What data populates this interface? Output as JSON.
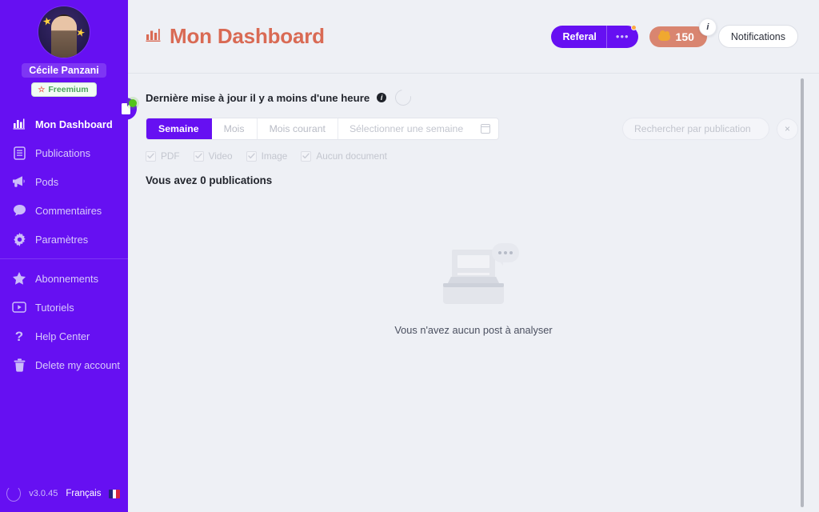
{
  "sidebar": {
    "avatar_alt": "user-avatar-photo",
    "username": "Cécile Panzani",
    "plan": "Freemium",
    "plan_icon": "star-outline-icon",
    "nav_groups": [
      {
        "items": [
          {
            "label": "Mon Dashboard",
            "icon": "bar-chart-icon",
            "active": true
          },
          {
            "label": "Publications",
            "icon": "document-icon",
            "active": false
          },
          {
            "label": "Pods",
            "icon": "megaphone-icon",
            "active": false
          },
          {
            "label": "Commentaires",
            "icon": "speech-bubble-icon",
            "active": false
          },
          {
            "label": "Paramètres",
            "icon": "gear-icon",
            "active": false
          }
        ]
      },
      {
        "items": [
          {
            "label": "Abonnements",
            "icon": "star-filled-icon",
            "active": false
          },
          {
            "label": "Tutoriels",
            "icon": "video-play-icon",
            "active": false
          },
          {
            "label": "Help Center",
            "icon": "question-mark-icon",
            "active": false
          },
          {
            "label": "Delete my account",
            "icon": "trash-icon",
            "active": false
          }
        ]
      }
    ],
    "footer": {
      "refresh_icon": "refresh-circle-icon",
      "version": "v3.0.45",
      "language": "Français",
      "flag": "french-flag-icon"
    },
    "collapse_toggle_icon": "side-panel-toggle-icon",
    "status_dot": "online-status-dot"
  },
  "header": {
    "title": "Mon Dashboard",
    "title_icon": "bar-chart-icon",
    "referal": {
      "label": "Referal",
      "more_icon": "ellipsis-icon",
      "badge_dot": "orange-notification-dot"
    },
    "credits": {
      "value": "150",
      "coin_icon": "coin-icon",
      "info_icon": "i"
    },
    "notifications_label": "Notifications"
  },
  "content": {
    "update_text": "Dernière mise à jour il y a moins d'une heure",
    "update_info_icon": "i",
    "reload_icon": "reload-icon",
    "period_tabs": [
      {
        "label": "Semaine",
        "active": true
      },
      {
        "label": "Mois",
        "active": false
      },
      {
        "label": "Mois courant",
        "active": false
      }
    ],
    "week_picker": {
      "placeholder": "Sélectionner une semaine",
      "value": "",
      "icon": "calendar-icon"
    },
    "search": {
      "placeholder": "Rechercher par publication",
      "value": "",
      "clear_icon": "×"
    },
    "type_filters": [
      {
        "label": "PDF",
        "checked": true
      },
      {
        "label": "Video",
        "checked": true
      },
      {
        "label": "Image",
        "checked": true
      },
      {
        "label": "Aucun document",
        "checked": true
      }
    ],
    "count_title": "Vous avez 0 publications",
    "empty_state": {
      "illustration": "empty-inbox-illustration",
      "text": "Vous n'avez aucun post à analyser"
    }
  },
  "colors": {
    "sidebar_purple": "#6610f2",
    "accent_coral": "#d96a54",
    "coin_badge": "#d98570",
    "page_bg": "#eef0f5"
  }
}
